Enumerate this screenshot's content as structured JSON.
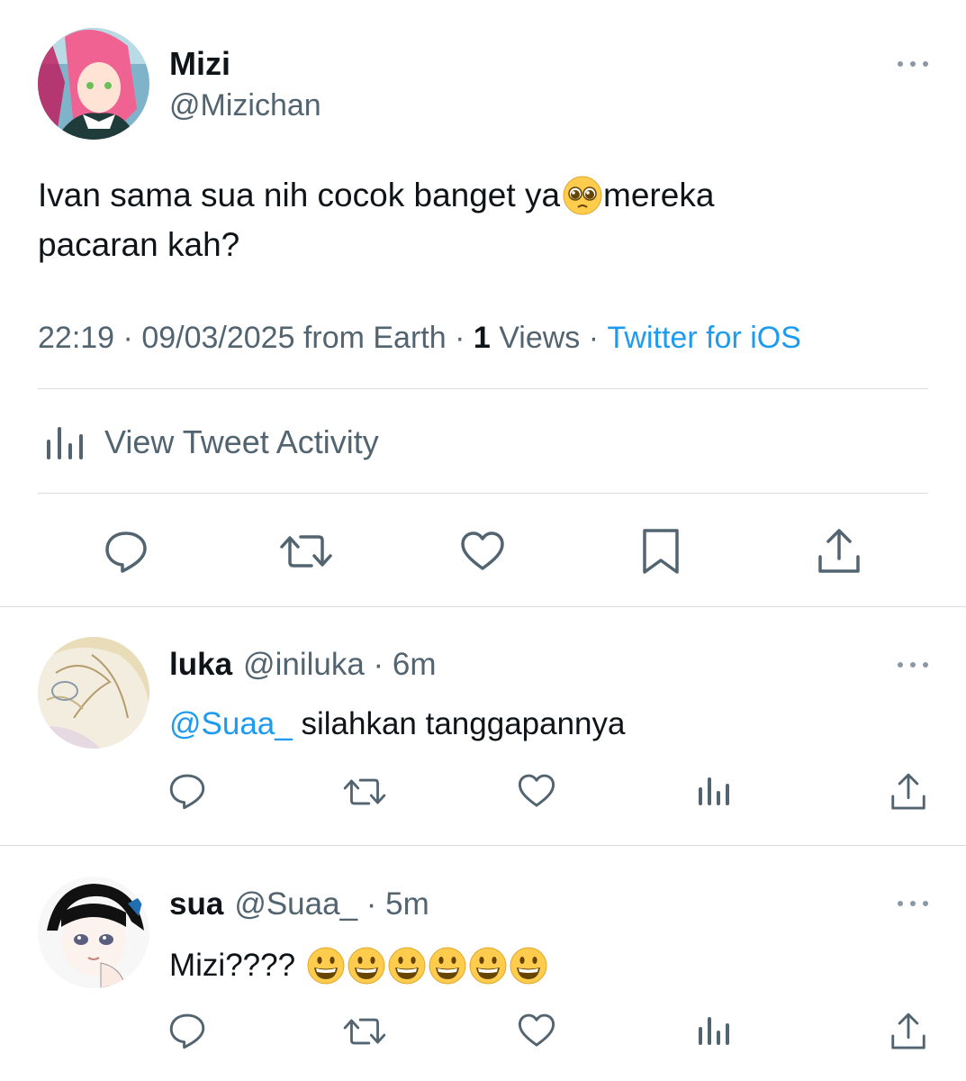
{
  "main_tweet": {
    "author_name": "Mizi",
    "author_handle": "@Mizichan",
    "text_line1": "Ivan sama sua nih cocok banget ya",
    "text_emoji": "pleading-face",
    "text_line1_after": " mereka",
    "text_line2": "pacaran kah?",
    "time": "22:19",
    "sep1": " · ",
    "date": "09/03/2025 from Earth",
    "sep2": " · ",
    "views_count": "1",
    "views_label": " Views",
    "sep3": " · ",
    "source": "Twitter for iOS",
    "activity_label": "View Tweet Activity",
    "actions": [
      "reply-icon",
      "retweet-icon",
      "like-icon",
      "bookmark-icon",
      "share-icon"
    ]
  },
  "replies": [
    {
      "author_name": "luka",
      "author_handle": "@iniluka",
      "sep": " · ",
      "age": "6m",
      "mention": "@Suaa_",
      "text": " silahkan tanggapannya",
      "actions": [
        "reply-icon",
        "retweet-icon",
        "like-icon",
        "analytics-icon",
        "share-icon"
      ]
    },
    {
      "author_name": "sua",
      "author_handle": "@Suaa_",
      "sep": " · ",
      "age": "5m",
      "text": "Mizi????",
      "emoji_count": 6,
      "emoji": "grinning-face",
      "actions": [
        "reply-icon",
        "retweet-icon",
        "like-icon",
        "analytics-icon",
        "share-icon"
      ]
    }
  ],
  "colors": {
    "text": "#0f1419",
    "muted": "#536471",
    "link": "#1d9bf0",
    "divider": "#d9dde1"
  }
}
